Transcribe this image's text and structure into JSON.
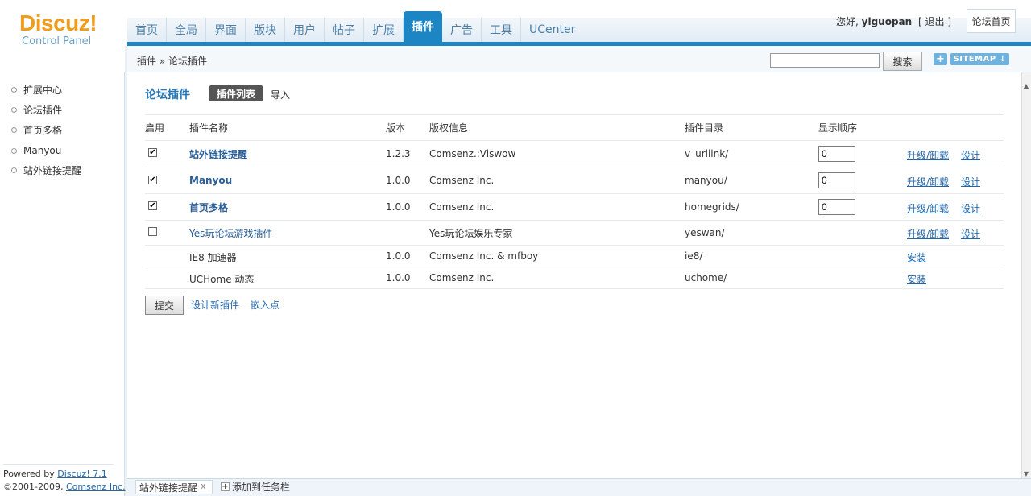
{
  "logo": {
    "main": "Discuz!",
    "sub": "Control Panel"
  },
  "nav": {
    "tabs": [
      "首页",
      "全局",
      "界面",
      "版块",
      "用户",
      "帖子",
      "扩展",
      "插件",
      "广告",
      "工具",
      "UCenter"
    ],
    "active": "插件"
  },
  "user": {
    "greeting": "您好,",
    "name": "yiguopan",
    "logout": "[ 退出 ]",
    "home_button": "论坛首页"
  },
  "breadcrumb": "插件 » 论坛插件",
  "search": {
    "button": "搜索",
    "value": ""
  },
  "top_buttons": {
    "plus": "+",
    "sitemap": "SITEMAP ↓"
  },
  "sidebar": {
    "items": [
      "扩展中心",
      "论坛插件",
      "首页多格",
      "Manyou",
      "站外链接提醒"
    ],
    "footer_powered": "Powered by ",
    "footer_brand": "Discuz! 7.1",
    "footer_copy": "©2001-2009, ",
    "footer_company": "Comsenz Inc."
  },
  "page": {
    "title": "论坛插件",
    "tabs": [
      "插件列表",
      "导入"
    ]
  },
  "table": {
    "headers": [
      "启用",
      "插件名称",
      "版本",
      "版权信息",
      "插件目录",
      "显示顺序"
    ],
    "rows": [
      {
        "enabled": true,
        "name": "站外链接提醒",
        "bold": true,
        "version": "1.2.3",
        "copyright": "Comsenz.:Viswow",
        "dir": "v_urllink/",
        "order": "0",
        "actions": [
          "升级/卸载",
          "设计"
        ]
      },
      {
        "enabled": true,
        "name": "Manyou",
        "bold": true,
        "version": "1.0.0",
        "copyright": "Comsenz Inc.",
        "dir": "manyou/",
        "order": "0",
        "actions": [
          "升级/卸载",
          "设计"
        ]
      },
      {
        "enabled": true,
        "name": "首页多格",
        "bold": true,
        "version": "1.0.0",
        "copyright": "Comsenz Inc.",
        "dir": "homegrids/",
        "order": "0",
        "actions": [
          "升级/卸载",
          "设计"
        ]
      },
      {
        "enabled": false,
        "name": "Yes玩论坛游戏插件",
        "bold": false,
        "version": "",
        "copyright": "Yes玩论坛娱乐专家",
        "dir": "yeswan/",
        "order": null,
        "actions": [
          "升级/卸载",
          "设计"
        ]
      },
      {
        "enabled": null,
        "name": "IE8 加速器",
        "bold": false,
        "version": "1.0.0",
        "copyright": "Comsenz Inc. & mfboy",
        "dir": "ie8/",
        "order": null,
        "actions": [
          "安装"
        ]
      },
      {
        "enabled": null,
        "name": "UCHome 动态",
        "bold": false,
        "version": "1.0.0",
        "copyright": "Comsenz Inc.",
        "dir": "uchome/",
        "order": null,
        "actions": [
          "安装"
        ]
      }
    ]
  },
  "footer_actions": {
    "submit": "提交",
    "design_new": "设计新插件",
    "hooks": "嵌入点"
  },
  "taskbar": {
    "item": "站外链接提醒",
    "close": "x",
    "add_box": "+",
    "add": "添加到任务栏"
  },
  "colors": {
    "accent": "#1c86c4",
    "link": "#2366a8",
    "logo": "#ee9d1c"
  }
}
